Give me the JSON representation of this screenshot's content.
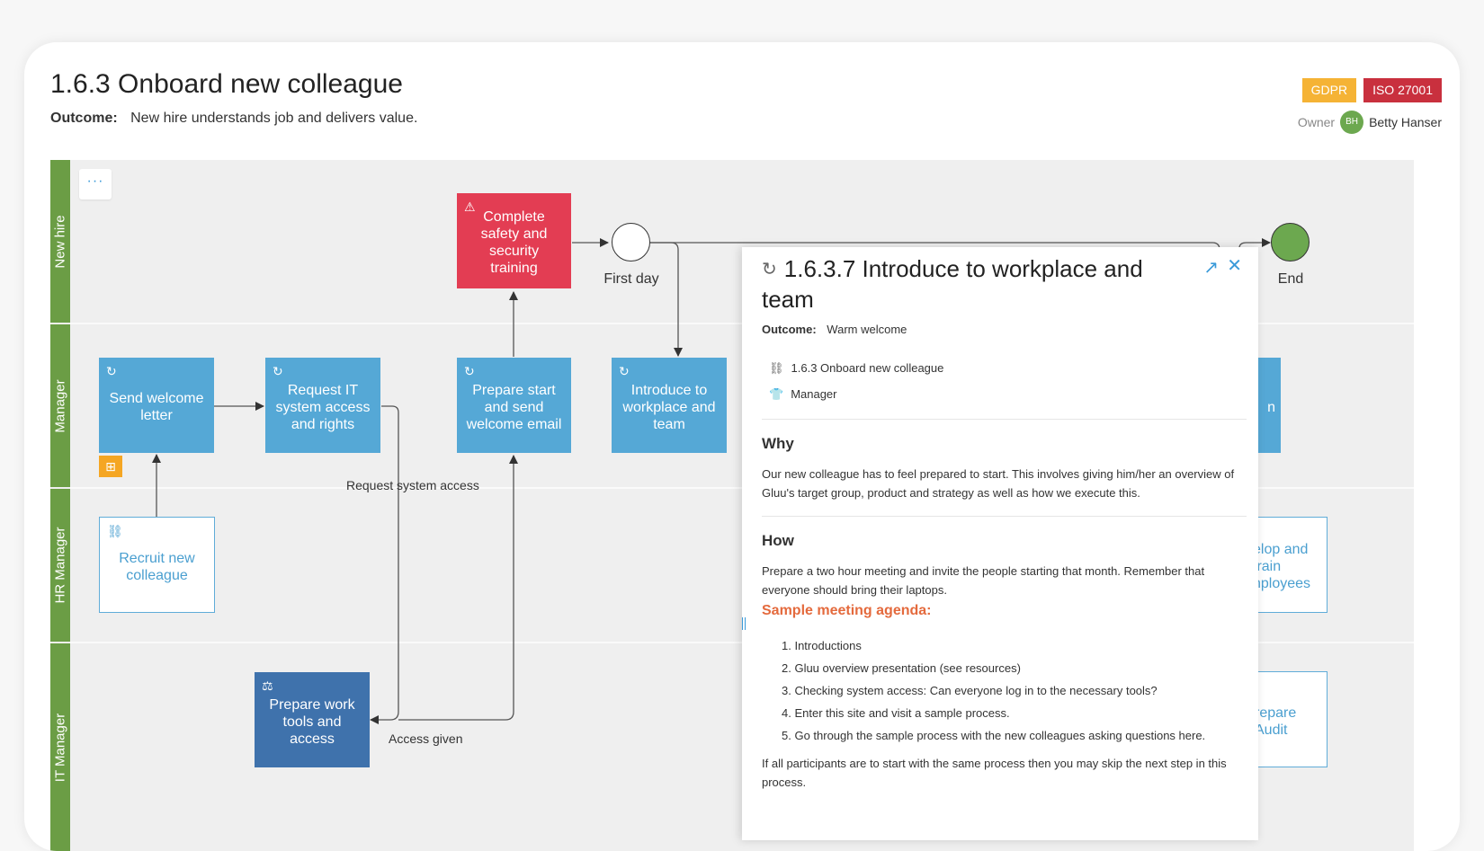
{
  "header": {
    "title": "1.6.3 Onboard new colleague",
    "outcome_label": "Outcome:",
    "outcome_value": "New hire understands job and delivers value.",
    "tags": [
      {
        "label": "GDPR",
        "color": "#f5b335"
      },
      {
        "label": "ISO 27001",
        "color": "#c9303e"
      }
    ],
    "owner_label": "Owner",
    "owner_initials": "BH",
    "owner_name": "Betty Hanser"
  },
  "diagram": {
    "more_button": "···",
    "lanes": [
      "New hire",
      "Manager",
      "HR Manager",
      "IT Manager"
    ],
    "tasks": {
      "complete_training": "Complete safety and security training",
      "send_welcome_letter": "Send welcome letter",
      "request_it": "Request IT system access and rights",
      "prepare_start_email": "Prepare start and send welcome email",
      "introduce_workplace": "Introduce to workplace and team",
      "recruit": "Recruit new colleague",
      "prepare_tools": "Prepare work tools and access",
      "partial_manager": "n",
      "partial_hr": "elop and train nployees",
      "partial_it": "repare Audit"
    },
    "events": {
      "first_day": "First day",
      "end": "End"
    },
    "flow_labels": {
      "request_access": "Request system access",
      "access_given": "Access given"
    }
  },
  "panel": {
    "title": "1.6.3.7 Introduce to workplace and team",
    "outcome_label": "Outcome:",
    "outcome_value": "Warm welcome",
    "parent_process": "1.6.3 Onboard new colleague",
    "role": "Manager",
    "why_heading": "Why",
    "why_text": "Our new colleague has to feel prepared to start. This involves giving him/her an overview of Gluu's target group, product and strategy as well as how we execute this.",
    "how_heading": "How",
    "how_text": "Prepare a two hour meeting and invite the people starting that month. Remember that everyone should bring their laptops.",
    "agenda_heading": "Sample meeting agenda:",
    "agenda_items": [
      "1. Introductions",
      "2. Gluu overview presentation (see resources)",
      "3. Checking system access: Can everyone log in to the necessary tools?",
      "4. Enter this site and visit a sample process.",
      "5. Go through the sample process with the new colleagues asking questions here."
    ],
    "footer_text": "If all participants are to start with the same process then you may skip the next step in this process."
  },
  "colors": {
    "lane_green": "#6b9d45",
    "task_blue": "#55a8d6",
    "task_red": "#e33d53",
    "task_dark": "#3f72ac",
    "end_green": "#6ca84f",
    "accent": "#3a9ad9",
    "agenda_orange": "#e46a3d"
  },
  "icons": [
    "sync-icon",
    "warning-icon",
    "scale-icon",
    "process-icon",
    "subprocess-icon",
    "role-icon",
    "expand-icon",
    "close-icon"
  ]
}
